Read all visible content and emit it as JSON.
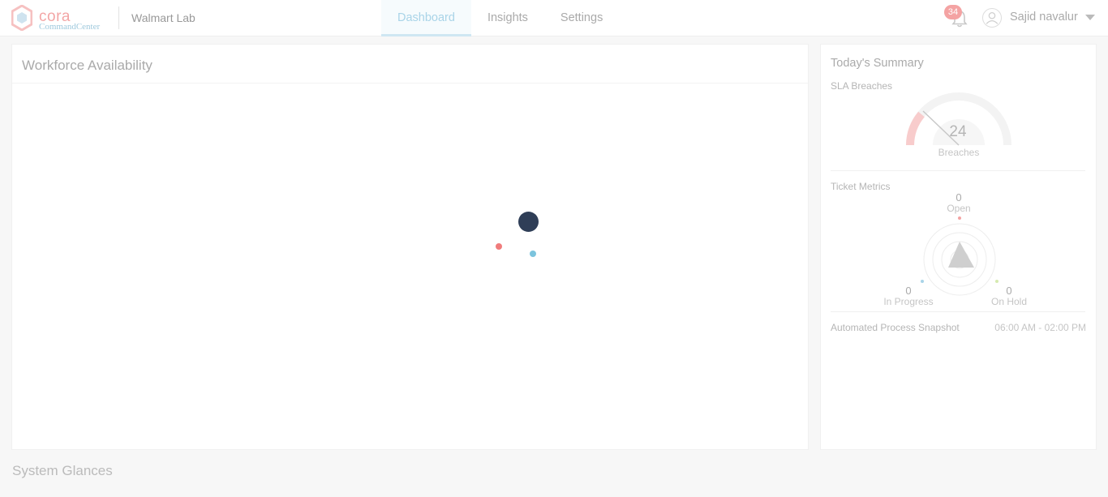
{
  "header": {
    "logo_word": "cora",
    "logo_sub": "CommandCenter",
    "org": "Walmart Lab",
    "nav": [
      {
        "label": "Dashboard",
        "active": true
      },
      {
        "label": "Insights",
        "active": false
      },
      {
        "label": "Settings",
        "active": false
      }
    ],
    "notification_count": "34",
    "user_name": "Sajid navalur",
    "icons": [
      "bell-icon",
      "user-avatar-icon",
      "chevron-down-icon"
    ]
  },
  "workforce": {
    "title": "Workforce Availability",
    "loading": true
  },
  "summary": {
    "title": "Today's Summary",
    "sla": {
      "label": "SLA Breaches",
      "value": "24",
      "unit_label": "Breaches"
    },
    "ticket_metrics": {
      "label": "Ticket Metrics",
      "open": {
        "value": "0",
        "label": "Open"
      },
      "in_progress": {
        "value": "0",
        "label": "In Progress"
      },
      "on_hold": {
        "value": "0",
        "label": "On Hold"
      }
    },
    "snapshot": {
      "label": "Automated Process Snapshot",
      "time_range": "06:00 AM - 02:00 PM"
    }
  },
  "glances": {
    "title": "System Glances"
  },
  "colors": {
    "accent": "#a9d4e8",
    "badge": "#f4a3a3",
    "loader_dark": "#2f3e57",
    "loader_red": "#f07c7c",
    "loader_blue": "#7cc4dd"
  }
}
